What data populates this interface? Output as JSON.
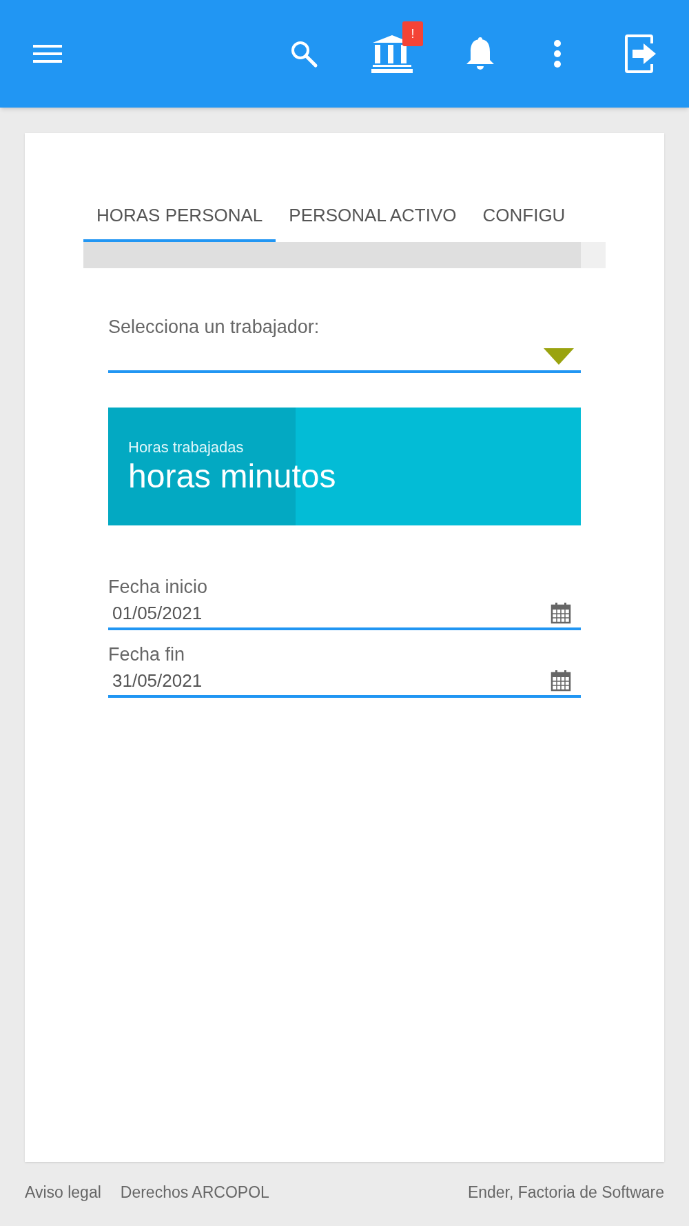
{
  "app_bar": {
    "notification_badge": "!"
  },
  "tabs": [
    {
      "label": "HORAS PERSONAL",
      "selected": true
    },
    {
      "label": "PERSONAL ACTIVO",
      "selected": false
    },
    {
      "label": "CONFIGU",
      "selected": false
    }
  ],
  "worker_select": {
    "label": "Selecciona un trabajador:"
  },
  "hours_card": {
    "caption": "Horas trabajadas",
    "value": "horas minutos"
  },
  "date_fields": [
    {
      "label": "Fecha inicio",
      "value": "01/05/2021"
    },
    {
      "label": "Fecha fin",
      "value": "31/05/2021"
    }
  ],
  "footer": {
    "links": [
      "Aviso legal",
      "Derechos ARCOPOL"
    ],
    "credit": "Ender, Factoria de Software"
  }
}
